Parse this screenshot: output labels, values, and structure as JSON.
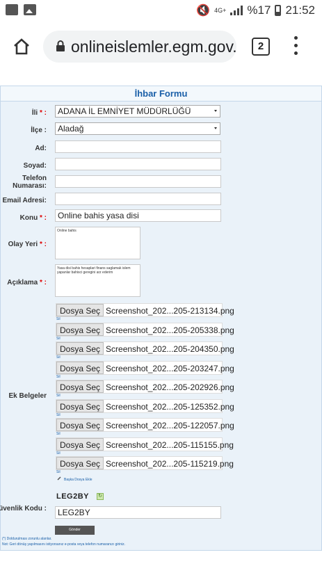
{
  "status": {
    "network": "4G+",
    "battery": "%17",
    "time": "21:52"
  },
  "browser": {
    "url": "onlineislemler.egm.gov.tr",
    "tab_count": "2"
  },
  "form": {
    "title": "İhbar Formu",
    "il_label": "İli",
    "il_value": "ADANA İL EMNİYET MÜDÜRLÜĞÜ",
    "ilce_label": "İlçe :",
    "ilce_value": "Aladağ",
    "ad_label": "Ad:",
    "soyad_label": "Soyad:",
    "telefon_label_1": "Telefon",
    "telefon_label_2": "Numarası:",
    "email_label": "Email Adresi:",
    "konu_label": "Konu",
    "konu_value": "Online bahis yasa disi",
    "olay_label": "Olay Yeri",
    "olay_value": "Online bahis",
    "aciklama_label": "Açıklama",
    "aciklama_value": "Yasa disi bahis hesaplari finans saglamak islem yapanlar bahisci geregini arz ederim",
    "ek_label": "Ek Belgeler",
    "file_button": "Dosya Seç",
    "remove_label": "Sil",
    "files": [
      "Screenshot_202...205-213134.png",
      "Screenshot_202...205-205338.png",
      "Screenshot_202...205-204350.png",
      "Screenshot_202...205-203247.png",
      "Screenshot_202...205-202926.png",
      "Screenshot_202...205-125352.png",
      "Screenshot_202...205-122057.png",
      "Screenshot_202...205-115155.png",
      "Screenshot_202...205-115219.png"
    ],
    "add_file": "Başka Dosya Ekle",
    "captcha_text": "LEG2BY",
    "guvenlik_label": "Güvenlik Kodu :",
    "guvenlik_value": "LEG2BY",
    "submit": "Gönder",
    "note1": "(*) Doldurulması zorunlu alanlar.",
    "note2": "Not: Geri dönüş yapılmasını istiyorsanız e-posta veya telefon numaranızı giriniz."
  }
}
